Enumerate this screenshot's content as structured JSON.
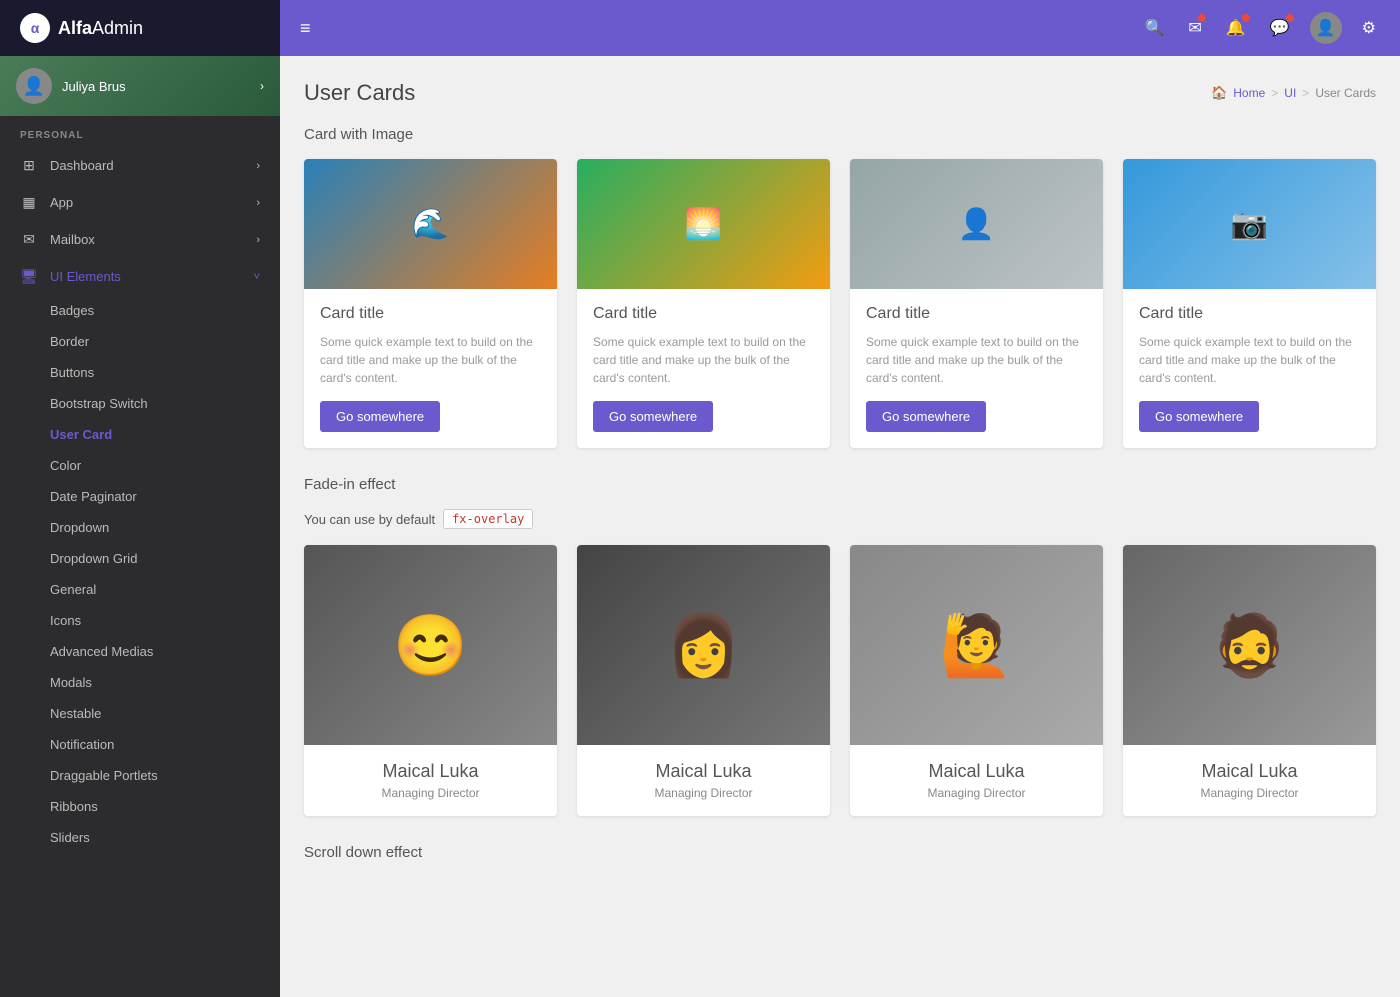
{
  "app": {
    "name_part1": "Alfa",
    "name_part2": "Admin"
  },
  "user": {
    "name": "Juliya Brus"
  },
  "sidebar": {
    "section_label": "PERSONAL",
    "items": [
      {
        "id": "dashboard",
        "label": "Dashboard",
        "icon": "⊞",
        "has_arrow": true
      },
      {
        "id": "app",
        "label": "App",
        "icon": "▦",
        "has_arrow": true
      },
      {
        "id": "mailbox",
        "label": "Mailbox",
        "icon": "✉",
        "has_arrow": true
      },
      {
        "id": "ui-elements",
        "label": "UI Elements",
        "icon": "🖥",
        "has_arrow": true,
        "active": true
      }
    ],
    "sub_items": [
      {
        "id": "badges",
        "label": "Badges"
      },
      {
        "id": "border",
        "label": "Border"
      },
      {
        "id": "buttons",
        "label": "Buttons"
      },
      {
        "id": "bootstrap-switch",
        "label": "Bootstrap Switch"
      },
      {
        "id": "user-card",
        "label": "User Card",
        "active": true
      },
      {
        "id": "color",
        "label": "Color"
      },
      {
        "id": "date-paginator",
        "label": "Date Paginator"
      },
      {
        "id": "dropdown",
        "label": "Dropdown"
      },
      {
        "id": "dropdown-grid",
        "label": "Dropdown Grid"
      },
      {
        "id": "general",
        "label": "General"
      },
      {
        "id": "icons",
        "label": "Icons"
      },
      {
        "id": "advanced-medias",
        "label": "Advanced Medias"
      },
      {
        "id": "modals",
        "label": "Modals"
      },
      {
        "id": "nestable",
        "label": "Nestable"
      },
      {
        "id": "notification",
        "label": "Notification"
      },
      {
        "id": "draggable-portlets",
        "label": "Draggable Portlets"
      },
      {
        "id": "ribbons",
        "label": "Ribbons"
      },
      {
        "id": "sliders",
        "label": "Sliders"
      }
    ]
  },
  "topbar": {
    "hamburger_icon": "≡"
  },
  "page": {
    "title": "User Cards",
    "breadcrumb": {
      "home": "Home",
      "separator1": ">",
      "ui": "UI",
      "separator2": ">",
      "current": "User Cards"
    }
  },
  "cards_section": {
    "title": "Card with Image",
    "cards": [
      {
        "title": "Card title",
        "text": "Some quick example text to build on the card title and make up the bulk of the card's content.",
        "btn_label": "Go somewhere",
        "img_class": "img-orange"
      },
      {
        "title": "Card title",
        "text": "Some quick example text to build on the card title and make up the bulk of the card's content.",
        "btn_label": "Go somewhere",
        "img_class": "img-green"
      },
      {
        "title": "Card title",
        "text": "Some quick example text to build on the card title and make up the bulk of the card's content.",
        "btn_label": "Go somewhere",
        "img_class": "img-gray"
      },
      {
        "title": "Card title",
        "text": "Some quick example text to build on the card title and make up the bulk of the card's content.",
        "btn_label": "Go somewhere",
        "img_class": "img-blue"
      }
    ]
  },
  "fade_section": {
    "title": "Fade-in effect",
    "desc_prefix": "You can use by default",
    "code_badge": "fx-overlay",
    "users": [
      {
        "name": "Maical Luka",
        "job_title": "Managing Director",
        "img_class": "img-bw1"
      },
      {
        "name": "Maical Luka",
        "job_title": "Managing Director",
        "img_class": "img-bw2"
      },
      {
        "name": "Maical Luka",
        "job_title": "Managing Director",
        "img_class": "img-bw3"
      },
      {
        "name": "Maical Luka",
        "job_title": "Managing Director",
        "img_class": "img-bw4"
      }
    ]
  },
  "scroll_section": {
    "title": "Scroll down effect"
  }
}
